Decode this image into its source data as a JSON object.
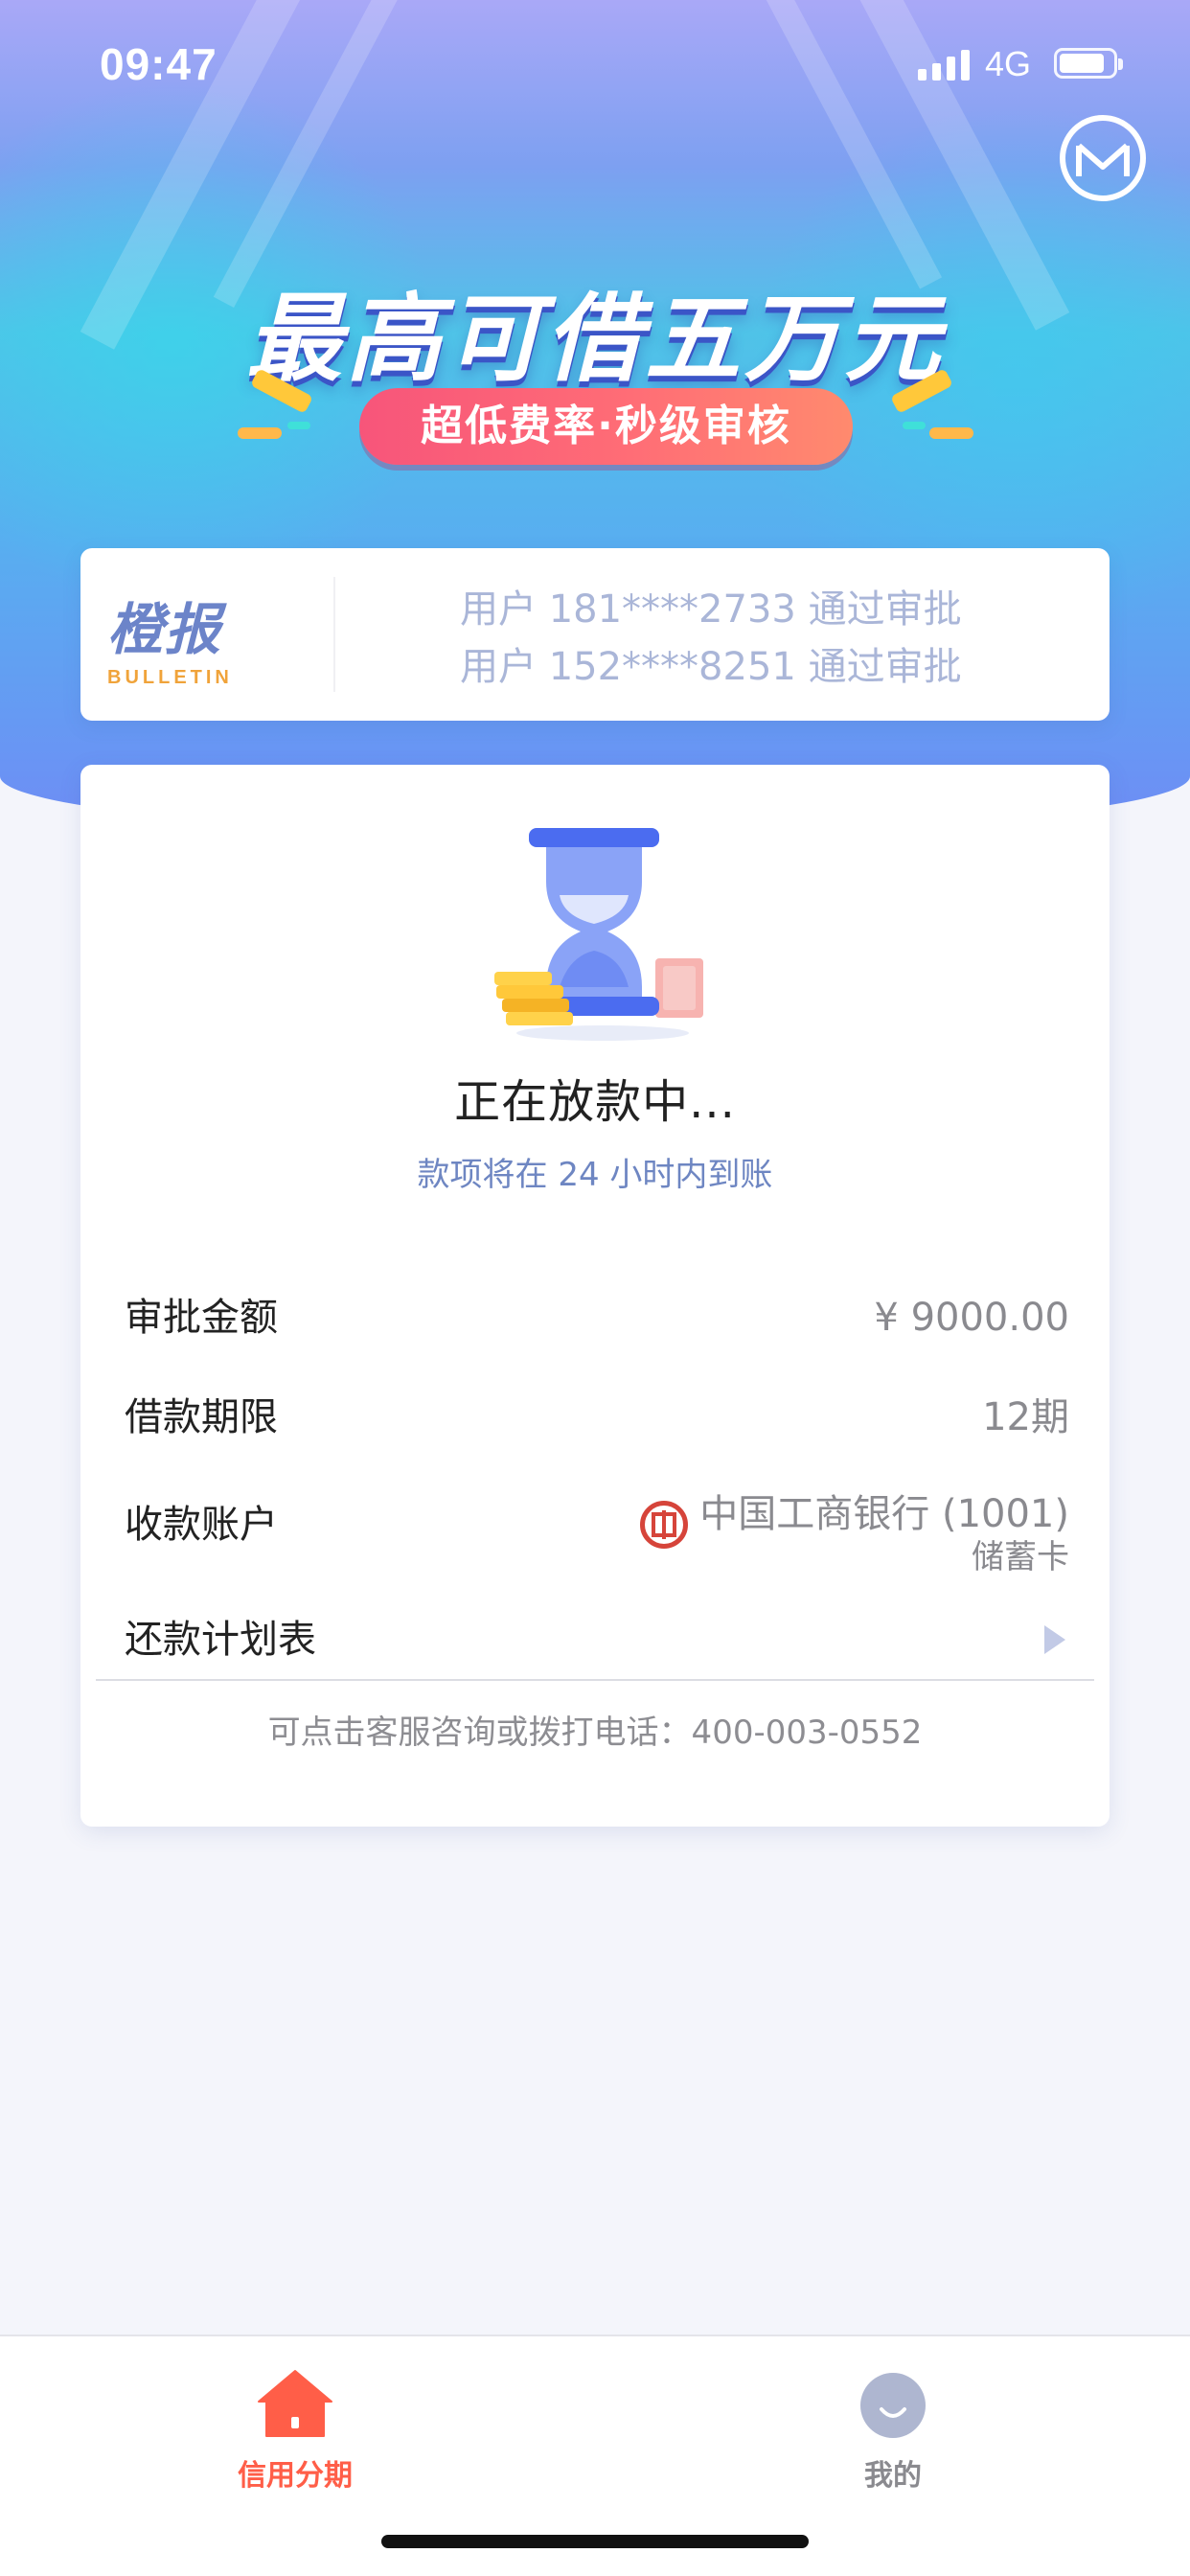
{
  "status_bar": {
    "time": "09:47",
    "network": "4G"
  },
  "hero": {
    "headline": "最高可借五万元",
    "subtitle": "超低费率·秒级审核"
  },
  "bulletin": {
    "logo_cn": "橙报",
    "logo_en": "BULLETIN",
    "lines": [
      "用户 181****2733 通过审批",
      "用户 152****8251 通过审批"
    ]
  },
  "loan_status": {
    "icon": "hourglass-icon",
    "title": "正在放款中...",
    "subtitle": "款项将在 24 小时内到账"
  },
  "details": {
    "amount": {
      "label": "审批金额",
      "value": "¥ 9000.00"
    },
    "term": {
      "label": "借款期限",
      "value": "12期"
    },
    "account": {
      "label": "收款账户",
      "bank": "中国工商银行 (1001)",
      "card_type": "储蓄卡"
    },
    "schedule": {
      "label": "还款计划表"
    }
  },
  "contact": "可点击客服咨询或拨打电话：400-003-0552",
  "tabbar": {
    "items": [
      {
        "label": "信用分期",
        "icon": "home-icon",
        "active": true
      },
      {
        "label": "我的",
        "icon": "profile-icon",
        "active": false
      }
    ]
  },
  "colors": {
    "accent": "#ff5e48",
    "inactive": "#8a8a8f",
    "link_blue": "#6e86c2",
    "bank_red": "#d6443a"
  }
}
